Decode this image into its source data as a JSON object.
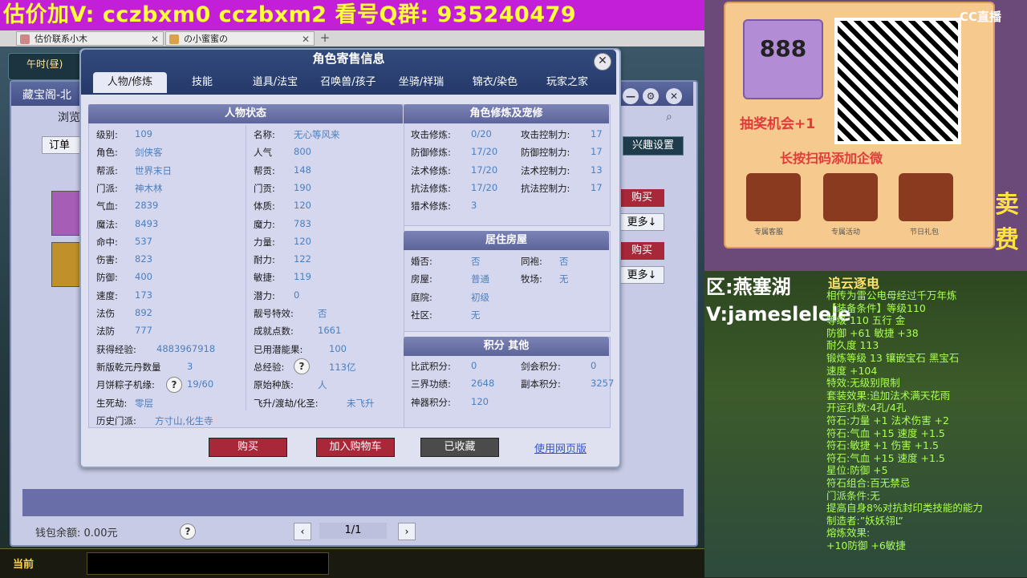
{
  "banner": {
    "text": "估价加V:  cczbxm0   cczbxm2   看号Q群:  935240479"
  },
  "browser_tabs": [
    {
      "label": "估价联系小木"
    },
    {
      "label": "の小蜜蜜の"
    }
  ],
  "game": {
    "time_label": "午时(昼)",
    "bg_window_title": "藏宝阁-北",
    "bg_browse": "浏览",
    "bg_order": "订单",
    "bg_interest": "兴趣设置",
    "bg_buy1": "购买",
    "bg_more1": "更多↓",
    "bg_buy2": "购买",
    "bg_more2": "更多↓",
    "wallet_label": "钱包余额:",
    "wallet_value": "0.00元",
    "page": "1/1",
    "current": "当前"
  },
  "dialog": {
    "title": "角色寄售信息",
    "tabs": [
      "人物/修炼",
      "技能",
      "道具/法宝",
      "召唤兽/孩子",
      "坐骑/祥瑞",
      "锦衣/染色",
      "玩家之家"
    ],
    "status_title": "人物状态",
    "left_col": [
      {
        "label": "级别:",
        "value": "109"
      },
      {
        "label": "角色:",
        "value": "剑侠客"
      },
      {
        "label": "帮派:",
        "value": "世界末日"
      },
      {
        "label": "门派:",
        "value": "神木林"
      },
      {
        "label": "气血:",
        "value": "2839"
      },
      {
        "label": "魔法:",
        "value": "8493"
      },
      {
        "label": "命中:",
        "value": "537"
      },
      {
        "label": "伤害:",
        "value": "823"
      },
      {
        "label": "防御:",
        "value": "400"
      },
      {
        "label": "速度:",
        "value": "173"
      },
      {
        "label": "法伤",
        "value": "892"
      },
      {
        "label": "法防",
        "value": "777"
      },
      {
        "label": "获得经验:",
        "value": "4883967918"
      },
      {
        "label": "新版乾元丹数量",
        "value": "3"
      },
      {
        "label": "月饼粽子机缘:",
        "value": "19/60"
      },
      {
        "label": "生死劫:",
        "value": "零层"
      },
      {
        "label": "历史门派:",
        "value": "方寸山,化生寺"
      }
    ],
    "mid_col": [
      {
        "label": "名称:",
        "value": "无心等风来"
      },
      {
        "label": "人气",
        "value": "800"
      },
      {
        "label": "帮贡:",
        "value": "148"
      },
      {
        "label": "门贡:",
        "value": "190"
      },
      {
        "label": "体质:",
        "value": "120"
      },
      {
        "label": "魔力:",
        "value": "783"
      },
      {
        "label": "力量:",
        "value": "120"
      },
      {
        "label": "耐力:",
        "value": "122"
      },
      {
        "label": "敏捷:",
        "value": "119"
      },
      {
        "label": "潜力:",
        "value": "0"
      },
      {
        "label": "靓号特效:",
        "value": "否"
      },
      {
        "label": "成就点数:",
        "value": "1661"
      },
      {
        "label": "已用潜能果:",
        "value": "100"
      },
      {
        "label": "总经验:",
        "value": "113亿"
      },
      {
        "label": "原始种族:",
        "value": "人"
      },
      {
        "label": "飞升/渡劫/化圣:",
        "value": "未飞升"
      }
    ],
    "cultivation_title": "角色修炼及宠修",
    "cultivation": [
      {
        "l1": "攻击修炼:",
        "v1": "0/20",
        "l2": "攻击控制力:",
        "v2": "17"
      },
      {
        "l1": "防御修炼:",
        "v1": "17/20",
        "l2": "防御控制力:",
        "v2": "17"
      },
      {
        "l1": "法术修炼:",
        "v1": "17/20",
        "l2": "法术控制力:",
        "v2": "13"
      },
      {
        "l1": "抗法修炼:",
        "v1": "17/20",
        "l2": "抗法控制力:",
        "v2": "17"
      },
      {
        "l1": "猎术修炼:",
        "v1": "3",
        "l2": "",
        "v2": ""
      }
    ],
    "house_title": "居住房屋",
    "house": [
      {
        "l1": "婚否:",
        "v1": "否",
        "l2": "同袍:",
        "v2": "否"
      },
      {
        "l1": "房屋:",
        "v1": "普通",
        "l2": "牧场:",
        "v2": "无"
      },
      {
        "l1": "庭院:",
        "v1": "初级",
        "l2": "",
        "v2": ""
      },
      {
        "l1": "社区:",
        "v1": "无",
        "l2": "",
        "v2": ""
      }
    ],
    "points_title": "积分 其他",
    "points": [
      {
        "l1": "比武积分:",
        "v1": "0",
        "l2": "剑会积分:",
        "v2": "0"
      },
      {
        "l1": "三界功绩:",
        "v1": "2648",
        "l2": "副本积分:",
        "v2": "3257"
      },
      {
        "l1": "神器积分:",
        "v1": "120",
        "l2": "",
        "v2": ""
      }
    ],
    "buy_btn": "购买",
    "cart_btn": "加入购物车",
    "fav_btn": "已收藏",
    "web_link": "使用网页版"
  },
  "stream": {
    "logo": "CC直播",
    "badge_num": "888",
    "lottery": "抽奖机会+1",
    "scan_text": "长按扫码添加企微",
    "icons": [
      "专属客服",
      "专属活动",
      "节日礼包"
    ],
    "sell_text": "卖",
    "fee_text": "费",
    "area": "区:燕塞湖",
    "vx": "V:jameslelele",
    "item_title": "追云逐电",
    "item_lines": [
      "相传为雷公电母经过千万年炼",
      "【装备条件】等级110",
      "等级 110  五行 金",
      "防御 +61  敏捷 +38",
      "耐久度 113",
      "锻炼等级 13  镶嵌宝石 黑宝石",
      "速度 +104",
      "特效:无级别限制",
      "套装效果:追加法术满天花雨",
      "开运孔数:4孔/4孔",
      "符石:力量 +1 法术伤害 +2",
      "符石:气血 +15 速度 +1.5",
      "符石:敏捷 +1 伤害 +1.5",
      "符石:气血 +15 速度 +1.5",
      "星位:防御 +5",
      "符石组合:百无禁忌",
      "门派条件:无",
      "提高自身8%对抗封印类技能的能力",
      "制造者:”妖妖翎L”",
      "熔炼效果:",
      "+10防御 +6敏捷"
    ]
  }
}
